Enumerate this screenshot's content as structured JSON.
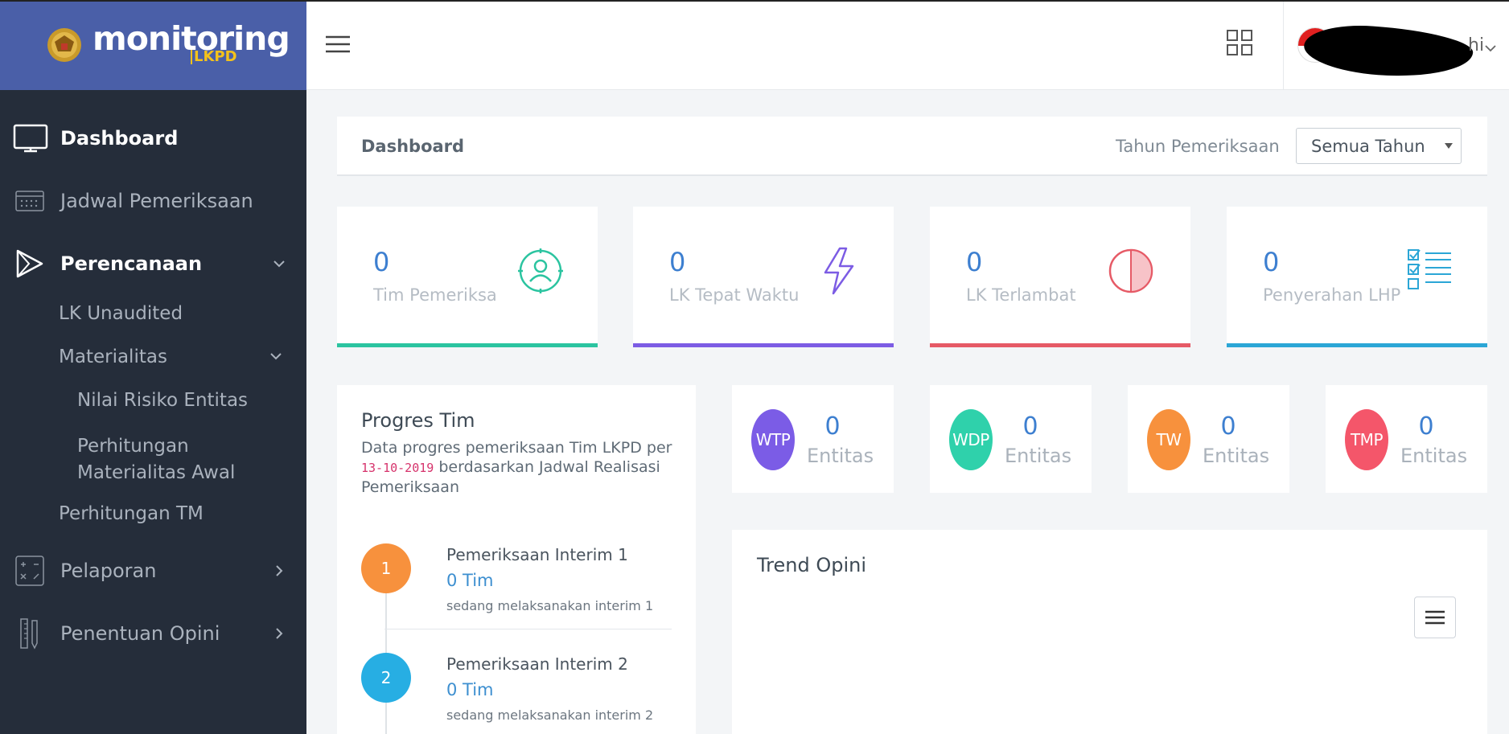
{
  "brand": {
    "name": "monitoring",
    "sub": "LKPD"
  },
  "sidebar": {
    "items": [
      {
        "label": "Dashboard",
        "icon": "monitor-icon"
      },
      {
        "label": "Jadwal Pemeriksaan",
        "icon": "calendar-icon"
      },
      {
        "label": "Perencanaan",
        "icon": "play-icon"
      },
      {
        "label": "Pelaporan",
        "icon": "calculator-icon"
      },
      {
        "label": "Penentuan Opini",
        "icon": "pencil-ruler-icon"
      }
    ],
    "sub_items": [
      {
        "label": "LK Unaudited"
      },
      {
        "label": "Materialitas"
      },
      {
        "label": "Nilai Risiko Entitas"
      },
      {
        "label": "Perhitungan Materialitas Awal"
      },
      {
        "label": "Perhitungan TM"
      }
    ]
  },
  "header": {
    "user_name_tail": "hi"
  },
  "page": {
    "title": "Dashboard",
    "year_label": "Tahun Pemeriksaan",
    "year_value": "Semua Tahun"
  },
  "stats": [
    {
      "value": "0",
      "label": "Tim Pemeriksa",
      "color": "#2bc4a0",
      "icon": "person-target-icon"
    },
    {
      "value": "0",
      "label": "LK Tepat Waktu",
      "color": "#7c5ce4",
      "icon": "lightning-icon"
    },
    {
      "value": "0",
      "label": "LK Terlambat",
      "color": "#e65a66",
      "icon": "half-circle-icon"
    },
    {
      "value": "0",
      "label": "Penyerahan LHP",
      "color": "#2ba6d6",
      "icon": "checklist-icon"
    }
  ],
  "progres": {
    "title": "Progres Tim",
    "desc_before": "Data progres pemeriksaan Tim LKPD per ",
    "desc_date": "13-10-2019",
    "desc_after": " berdasarkan Jadwal Realisasi Pemeriksaan",
    "steps": [
      {
        "number": "1",
        "title": "Pemeriksaan Interim 1",
        "count": "0 Tim",
        "note": "sedang melaksanakan interim 1",
        "color": "#f7913d"
      },
      {
        "number": "2",
        "title": "Pemeriksaan Interim 2",
        "count": "0 Tim",
        "note": "sedang melaksanakan interim 2",
        "color": "#27aee3"
      }
    ]
  },
  "opini": [
    {
      "code": "WTP",
      "value": "0",
      "unit": "Entitas",
      "color": "#7b5ce6"
    },
    {
      "code": "WDP",
      "value": "0",
      "unit": "Entitas",
      "color": "#2fd1ab"
    },
    {
      "code": "TW",
      "value": "0",
      "unit": "Entitas",
      "color": "#f7913d"
    },
    {
      "code": "TMP",
      "value": "0",
      "unit": "Entitas",
      "color": "#f4566a"
    }
  ],
  "trend": {
    "title": "Trend Opini"
  }
}
